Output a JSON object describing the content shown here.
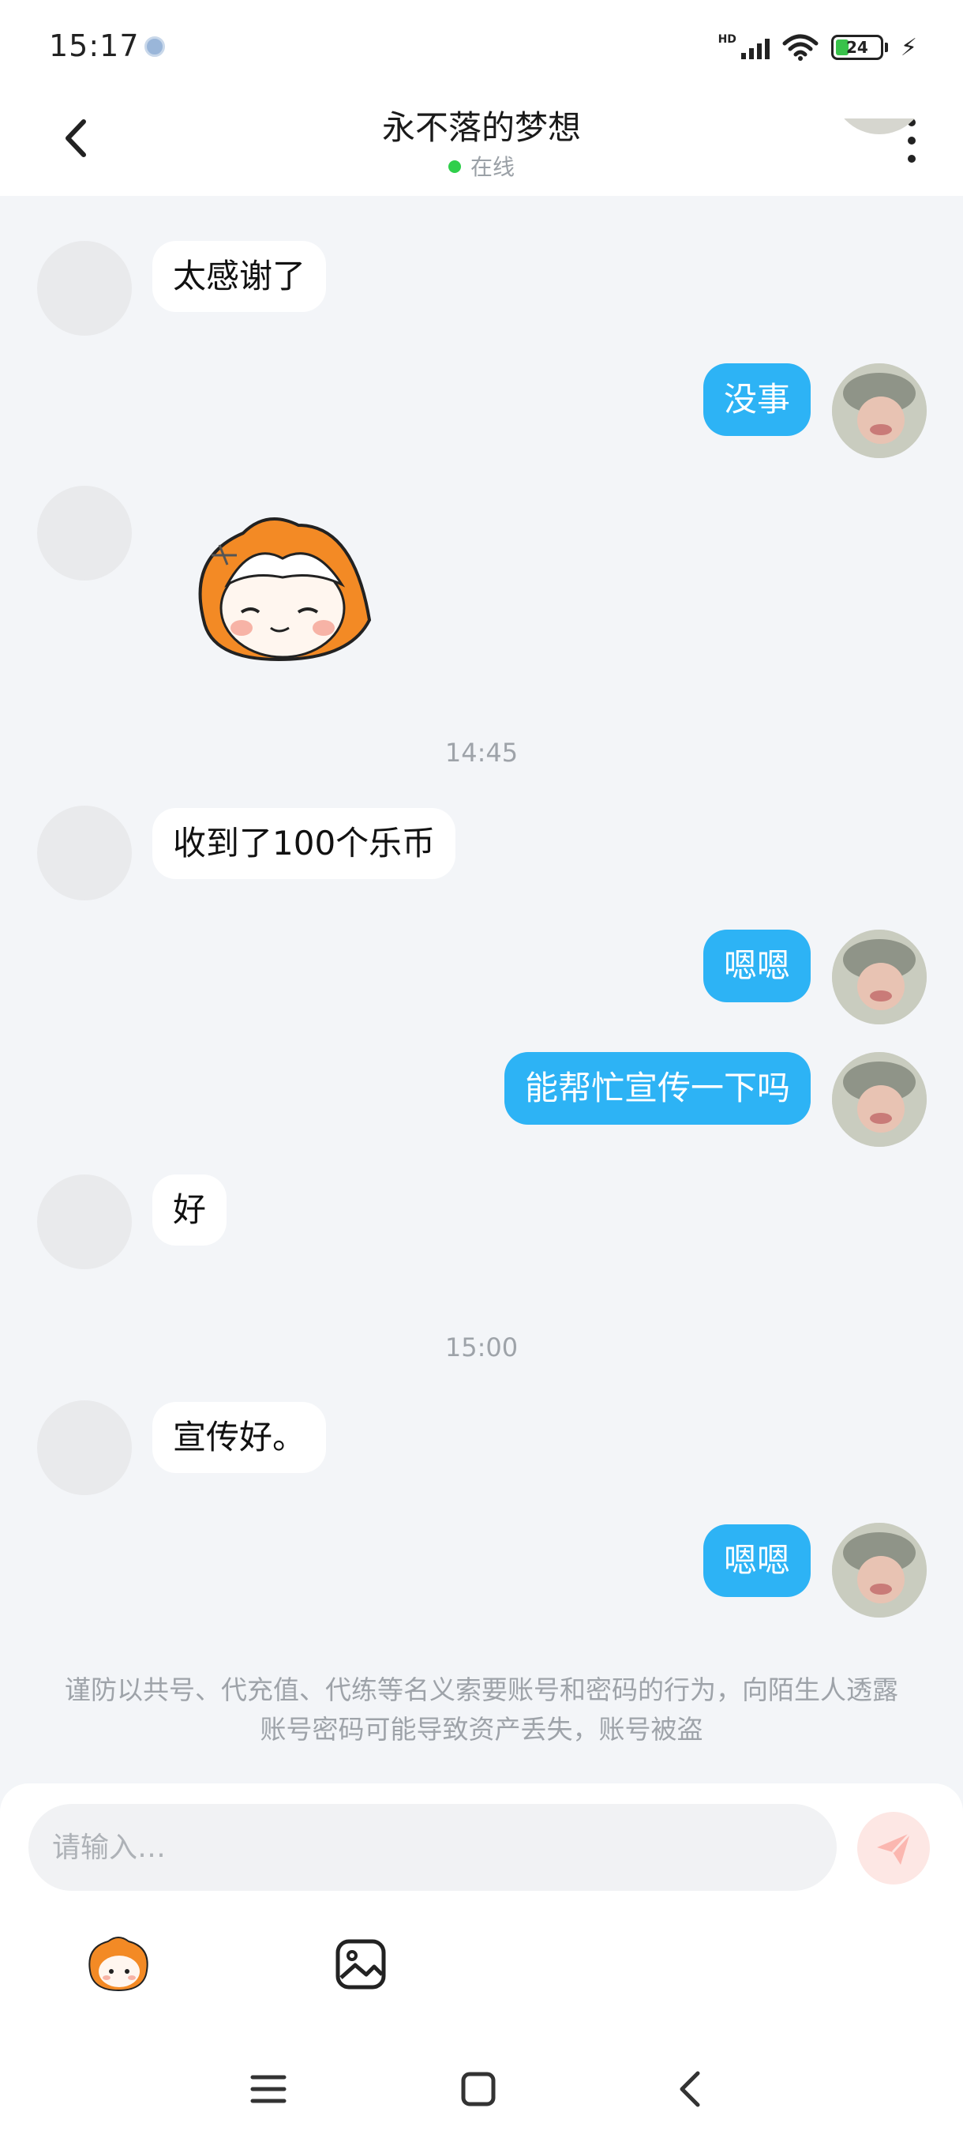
{
  "status_bar": {
    "time": "15:17",
    "network": "HD",
    "battery": "24"
  },
  "header": {
    "title": "永不落的梦想",
    "status": "在线",
    "status_color": "#2fcf4b"
  },
  "messages": [
    {
      "side": "left",
      "type": "text",
      "text": "太感谢了"
    },
    {
      "side": "right",
      "type": "text",
      "text": "没事"
    },
    {
      "side": "left",
      "type": "sticker",
      "icon": "orange-hair-girl-sticker"
    },
    {
      "type": "time",
      "text": "14:45"
    },
    {
      "side": "left",
      "type": "text",
      "text": "收到了100个乐币"
    },
    {
      "side": "right",
      "type": "text",
      "text": "嗯嗯"
    },
    {
      "side": "right",
      "type": "text",
      "text": "能帮忙宣传一下吗"
    },
    {
      "side": "left",
      "type": "text",
      "text": "好"
    },
    {
      "type": "time",
      "text": "15:00"
    },
    {
      "side": "left",
      "type": "text",
      "text": "宣传好。"
    },
    {
      "side": "right",
      "type": "text",
      "text": "嗯嗯"
    }
  ],
  "warning": "谨防以共号、代充值、代练等名义索要账号和密码的行为，向陌生人透露账号密码可能导致资产丢失，账号被盗",
  "input": {
    "placeholder": "请输入…",
    "value": ""
  },
  "colors": {
    "bubble_right": "#2db3f5",
    "send_button": "#fde7e4",
    "background": "#f3f5f8"
  }
}
